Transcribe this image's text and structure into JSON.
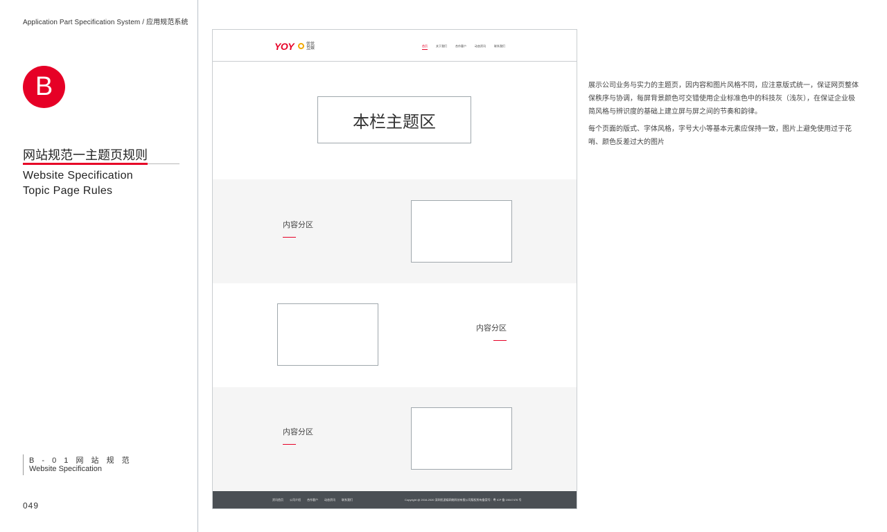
{
  "header": {
    "title": "Application Part Specification System / 应用规范系统"
  },
  "section_badge": {
    "letter": "B",
    "color": "#e60026"
  },
  "page_title": {
    "cn": "网站规范一主题页规则",
    "en_line1": "Website Specification",
    "en_line2": "Topic Page Rules"
  },
  "section_code": {
    "cn": "B - 0 1 网 站 规 范",
    "en": "Website Specification"
  },
  "page_number": "049",
  "mockup": {
    "logo": {
      "text": "YOY",
      "cn": "优优互娱"
    },
    "nav": [
      "首页",
      "关于我们",
      "合作客户",
      "动态资讯",
      "联系我们"
    ],
    "hero_label": "本栏主题区",
    "sections": [
      {
        "label": "内容分区"
      },
      {
        "label": "内容分区"
      },
      {
        "label": "内容分区"
      }
    ],
    "footer": {
      "links": [
        "资讯首页",
        "公司介绍",
        "合作客户",
        "动态资讯",
        "联系我们"
      ],
      "copyright": "Copyright @ 2016-2020 深圳优游娱网络科技有限公司版权所有备案号：粤 ICP 备 19047476 号"
    }
  },
  "description": {
    "p1": "展示公司业务与实力的主题页，因内容和图片风格不同，应注意版式统一，保证网页整体保秩序与协调，每屏背景颜色可交错使用企业标准色中的科技灰（浅灰），在保证企业极简风格与辨识度的基础上建立屏与屏之间的节奏和韵律。",
    "p2": "每个页面的版式、字体风格，字号大小等基本元素应保持一致，图片上避免使用过于花哨、颜色反差过大的图片"
  },
  "colors": {
    "accent": "#e60026",
    "light_gray": "#f5f5f5",
    "footer_gray": "#4a4f54"
  }
}
